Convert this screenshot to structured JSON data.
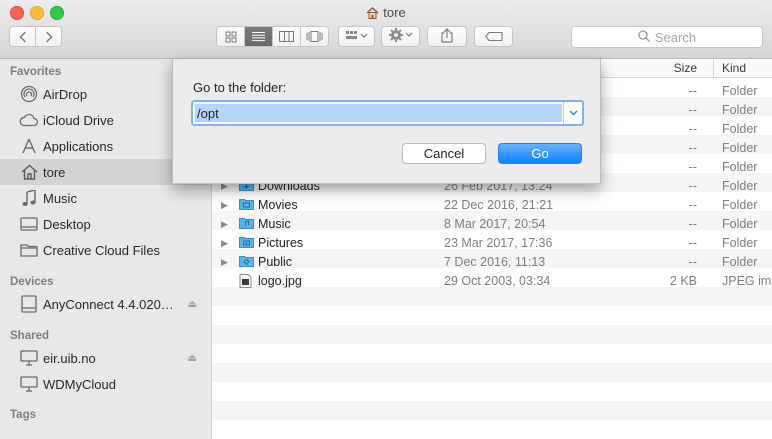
{
  "window": {
    "title": "tore"
  },
  "toolbar": {
    "search_placeholder": "Search",
    "icons": [
      "back-icon",
      "forward-icon",
      "icon-view-icon",
      "list-view-icon",
      "column-view-icon",
      "coverflow-view-icon",
      "arrange-icon",
      "action-gear-icon",
      "share-icon",
      "tag-icon"
    ]
  },
  "sidebar": {
    "favorites_header": "Favorites",
    "favorites": [
      {
        "label": "AirDrop",
        "icon": "airdrop-icon"
      },
      {
        "label": "iCloud Drive",
        "icon": "cloud-icon"
      },
      {
        "label": "Applications",
        "icon": "applications-icon"
      },
      {
        "label": "tore",
        "icon": "home-icon",
        "selected": true
      },
      {
        "label": "Music",
        "icon": "music-icon"
      },
      {
        "label": "Desktop",
        "icon": "desktop-icon"
      },
      {
        "label": "Creative Cloud Files",
        "icon": "folder-icon"
      }
    ],
    "devices_header": "Devices",
    "devices": [
      {
        "label": "AnyConnect 4.4.020…",
        "icon": "disk-icon"
      }
    ],
    "shared_header": "Shared",
    "shared": [
      {
        "label": "eir.uib.no",
        "icon": "server-icon"
      },
      {
        "label": "WDMyCloud",
        "icon": "server-icon"
      }
    ],
    "tags_header": "Tags"
  },
  "list": {
    "columns": {
      "size": "Size",
      "kind": "Kind"
    },
    "hidden_rows": [
      {
        "size": "--",
        "kind": "Folder"
      },
      {
        "size": "--",
        "kind": "Folder"
      },
      {
        "size": "--",
        "kind": "Folder"
      },
      {
        "size": "--",
        "kind": "Folder"
      },
      {
        "size": "--",
        "kind": "Folder"
      }
    ],
    "rows": [
      {
        "name": "Downloads",
        "date": "26 Feb 2017, 13:24",
        "size": "--",
        "kind": "Folder",
        "folder": true
      },
      {
        "name": "Movies",
        "date": "22 Dec 2016, 21:21",
        "size": "--",
        "kind": "Folder",
        "folder": true
      },
      {
        "name": "Music",
        "date": "8 Mar 2017, 20:54",
        "size": "--",
        "kind": "Folder",
        "folder": true
      },
      {
        "name": "Pictures",
        "date": "23 Mar 2017, 17:36",
        "size": "--",
        "kind": "Folder",
        "folder": true
      },
      {
        "name": "Public",
        "date": "7 Dec 2016, 11:13",
        "size": "--",
        "kind": "Folder",
        "folder": true
      },
      {
        "name": "logo.jpg",
        "date": "29 Oct 2003, 03:34",
        "size": "2 KB",
        "kind": "JPEG ima",
        "folder": false
      }
    ]
  },
  "dialog": {
    "label": "Go to the folder:",
    "path_value": "/opt",
    "cancel_label": "Cancel",
    "go_label": "Go"
  },
  "colors": {
    "accent": "#0d81ff",
    "folder": "#5ab4ec",
    "selection": "#b3d4fc"
  }
}
